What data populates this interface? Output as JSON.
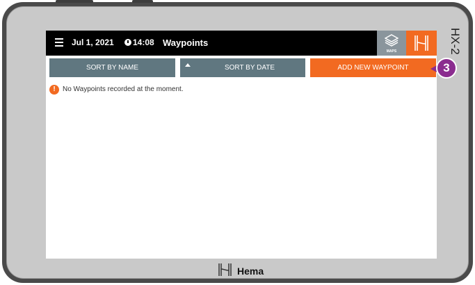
{
  "topbar": {
    "date": "Jul 1, 2021",
    "time": "14:08",
    "title": "Waypoints",
    "maps_label": "MAPS"
  },
  "toolbar": {
    "sort_by_name": "SORT BY NAME",
    "sort_by_date": "SORT BY DATE",
    "add_waypoint": "ADD NEW WAYPOINT"
  },
  "message": {
    "icon": "!",
    "text": "No Waypoints recorded at the moment."
  },
  "annotation": {
    "callout_number": "3"
  },
  "device": {
    "model_label": "HX-2",
    "brand": "Hema"
  },
  "colors": {
    "accent": "#f26a21",
    "button_gray": "#607780",
    "callout": "#8b2c8f",
    "topbar": "#000000"
  },
  "icons": [
    "menu-icon",
    "clock-icon",
    "layers-icon",
    "hema-logo-icon",
    "sort-up-icon",
    "alert-icon"
  ]
}
